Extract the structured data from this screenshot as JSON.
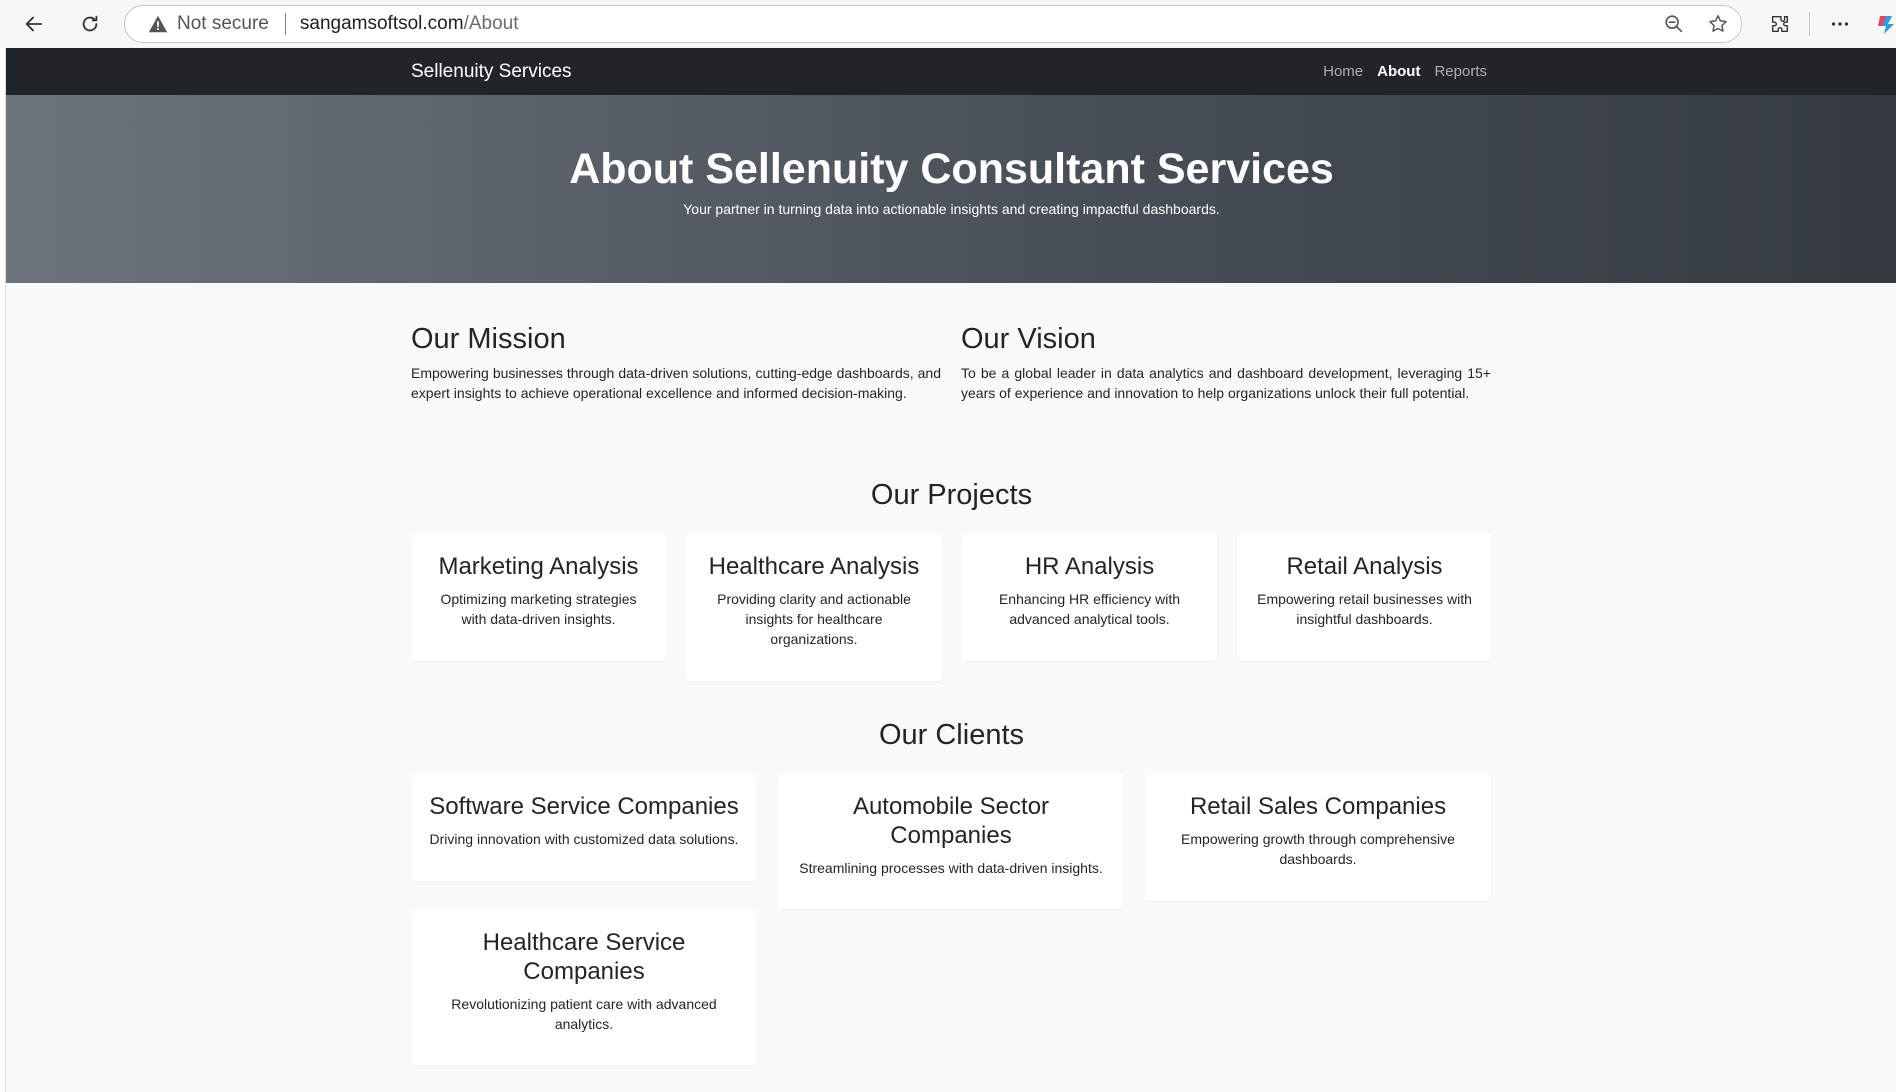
{
  "browser": {
    "security_label": "Not secure",
    "url_host": "sangamsoftsol.com",
    "url_path": "/About"
  },
  "site": {
    "brand": "Sellenuity Services",
    "nav": {
      "home": "Home",
      "about": "About",
      "reports": "Reports"
    }
  },
  "hero": {
    "title": "About Sellenuity Consultant Services",
    "subtitle": "Your partner in turning data into actionable insights and creating impactful dashboards."
  },
  "mission": {
    "title": "Our Mission",
    "text": "Empowering businesses through data-driven solutions, cutting-edge dashboards, and expert insights to achieve operational excellence and informed decision-making."
  },
  "vision": {
    "title": "Our Vision",
    "text": "To be a global leader in data analytics and dashboard development, leveraging 15+ years of experience and innovation to help organizations unlock their full potential."
  },
  "projects": {
    "title": "Our Projects",
    "items": [
      {
        "title": "Marketing Analysis",
        "text": "Optimizing marketing strategies with data-driven insights."
      },
      {
        "title": "Healthcare Analysis",
        "text": "Providing clarity and actionable insights for healthcare organizations."
      },
      {
        "title": "HR Analysis",
        "text": "Enhancing HR efficiency with advanced analytical tools."
      },
      {
        "title": "Retail Analysis",
        "text": "Empowering retail businesses with insightful dashboards."
      }
    ]
  },
  "clients": {
    "title": "Our Clients",
    "items": [
      {
        "title": "Software Service Companies",
        "text": "Driving innovation with customized data solutions."
      },
      {
        "title": "Automobile Sector Companies",
        "text": "Streamlining processes with data-driven insights."
      },
      {
        "title": "Retail Sales Companies",
        "text": "Empowering growth through comprehensive dashboards."
      },
      {
        "title": "Healthcare Service Companies",
        "text": "Revolutionizing patient care with advanced analytics."
      }
    ]
  }
}
